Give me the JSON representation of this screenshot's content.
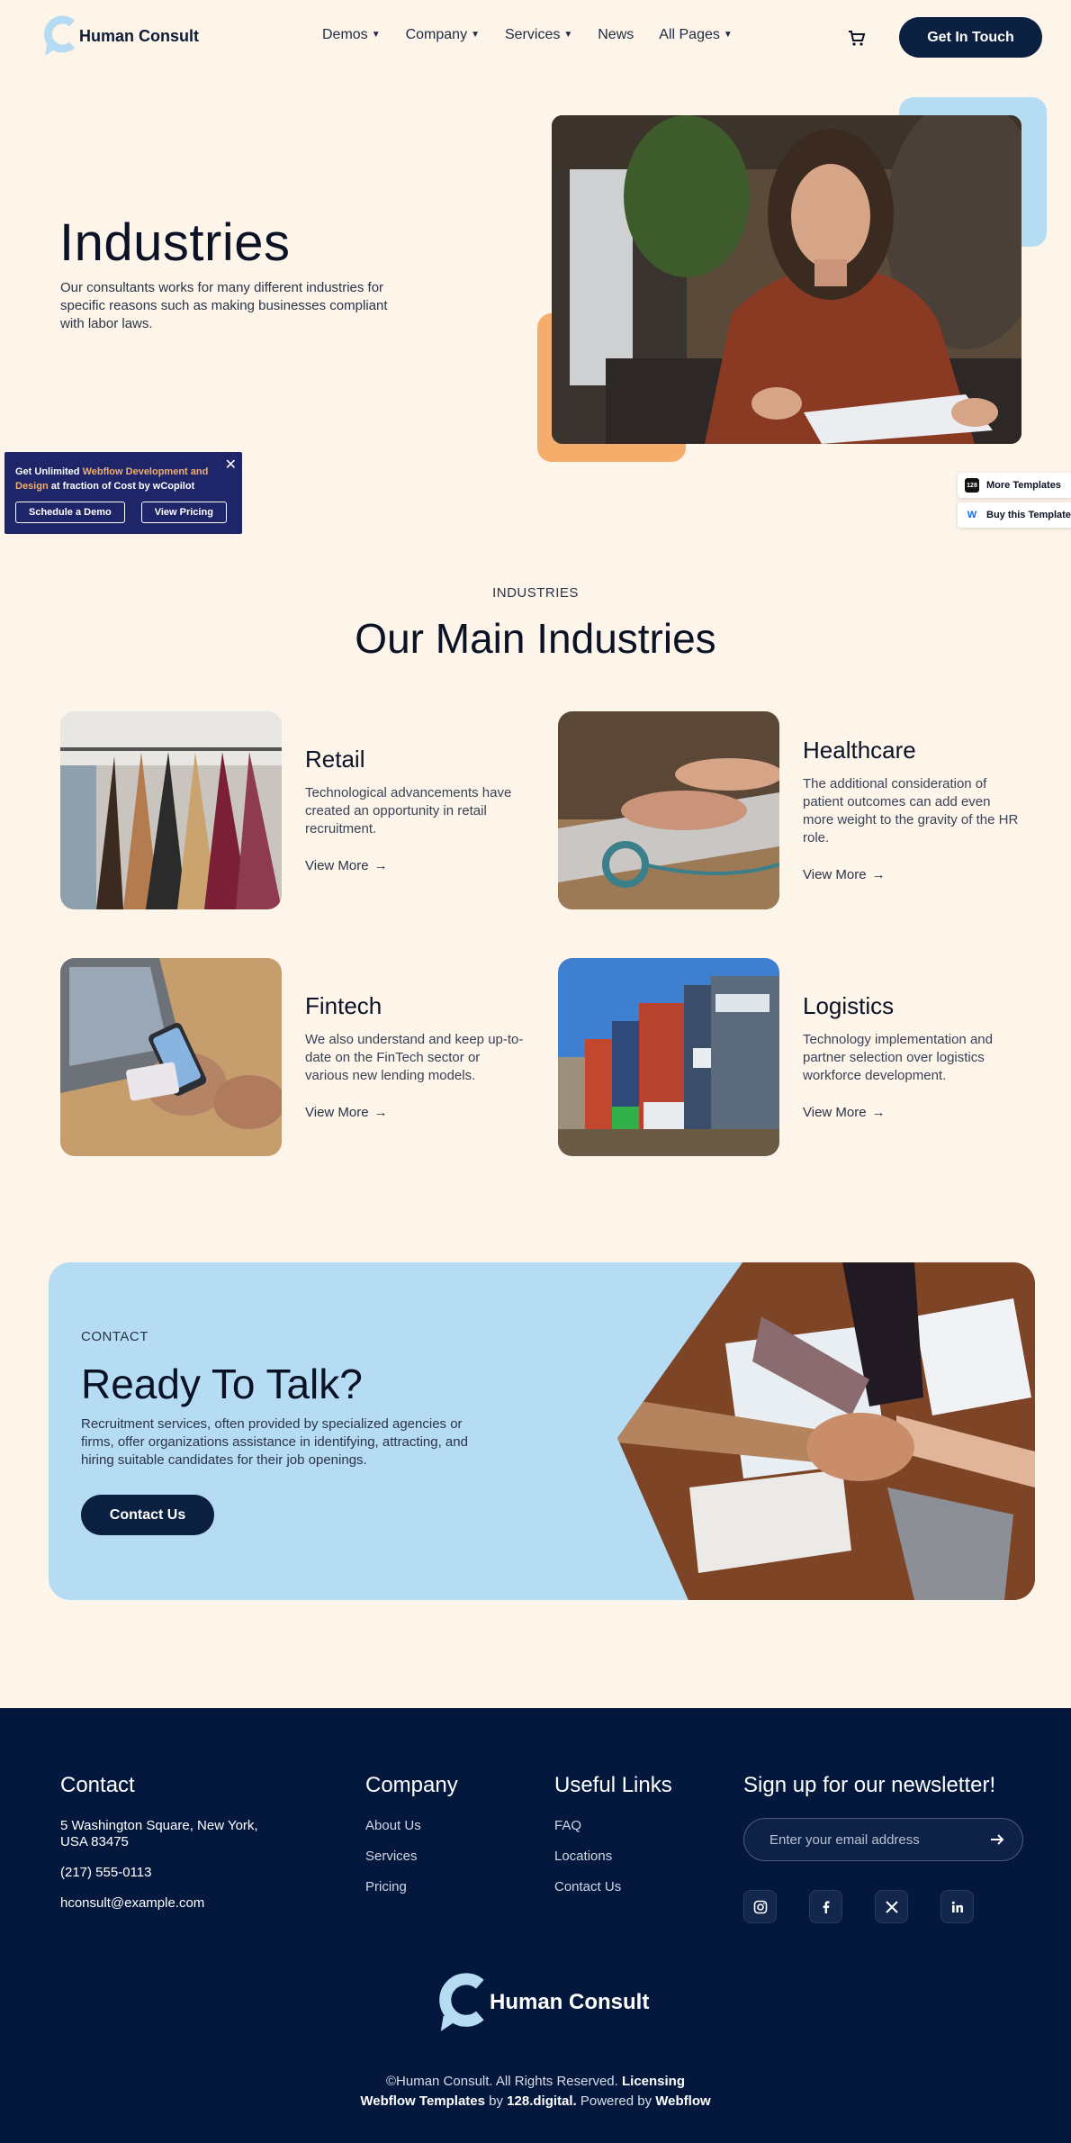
{
  "header": {
    "brand": "Human Consult",
    "nav": [
      {
        "label": "Demos",
        "dropdown": true
      },
      {
        "label": "Company",
        "dropdown": true
      },
      {
        "label": "Services",
        "dropdown": true
      },
      {
        "label": "News",
        "dropdown": false
      },
      {
        "label": "All Pages",
        "dropdown": true
      }
    ],
    "cart_icon": "cart-icon",
    "cta_label": "Get In Touch"
  },
  "hero": {
    "title": "Industries",
    "text": "Our consultants works for many different industries for specific reasons such as making businesses compliant with labor laws."
  },
  "promo": {
    "text_pre": "Get Unlimited ",
    "text_highlight": "Webflow Development and Design",
    "text_post": " at fraction of Cost by wCopilot",
    "demo_label": "Schedule a Demo",
    "pricing_label": "View Pricing"
  },
  "side_badges": {
    "more_templates": "More Templates",
    "buy_template": "Buy this Template",
    "more_templates_badge": "128"
  },
  "industries": {
    "eyebrow": "INDUSTRIES",
    "title": "Our Main Industries",
    "cards": [
      {
        "title": "Retail",
        "desc": "Technological advancements have created an opportunity in retail recruitment.",
        "link": "View More"
      },
      {
        "title": "Healthcare",
        "desc": "The additional consideration of patient outcomes can add even more weight to the gravity of the HR role.",
        "link": "View More"
      },
      {
        "title": "Fintech",
        "desc": "We also understand and keep up-to-date on the FinTech sector or various new lending models.",
        "link": "View More"
      },
      {
        "title": "Logistics",
        "desc": "Technology implementation and partner selection over logistics workforce development.",
        "link": "View More"
      }
    ]
  },
  "cta": {
    "eyebrow": "CONTACT",
    "title": "Ready To Talk?",
    "text": "Recruitment services, often provided by specialized agencies or firms, offer organizations assistance in identifying, attracting, and hiring suitable candidates for their job openings.",
    "button": "Contact Us"
  },
  "footer": {
    "contact": {
      "heading": "Contact",
      "address": "5 Washington Square, New York, USA 83475",
      "phone": "(217) 555-0113",
      "email": "hconsult@example.com"
    },
    "company": {
      "heading": "Company",
      "links": [
        "About Us",
        "Services",
        "Pricing"
      ]
    },
    "useful": {
      "heading": "Useful Links",
      "links": [
        "FAQ",
        "Locations",
        "Contact Us"
      ]
    },
    "newsletter": {
      "heading": "Sign up for our newsletter!",
      "placeholder": "Enter your email address",
      "socials": [
        "instagram-icon",
        "facebook-icon",
        "x-icon",
        "linkedin-icon"
      ]
    },
    "brand": "Human Consult",
    "copy": {
      "rights": "©Human Consult. All Rights Reserved.",
      "licensing": "Licensing",
      "templates": "Webflow Templates",
      "by": "by",
      "studio": "128.digital.",
      "powered": "Powered by",
      "platform": "Webflow"
    }
  }
}
